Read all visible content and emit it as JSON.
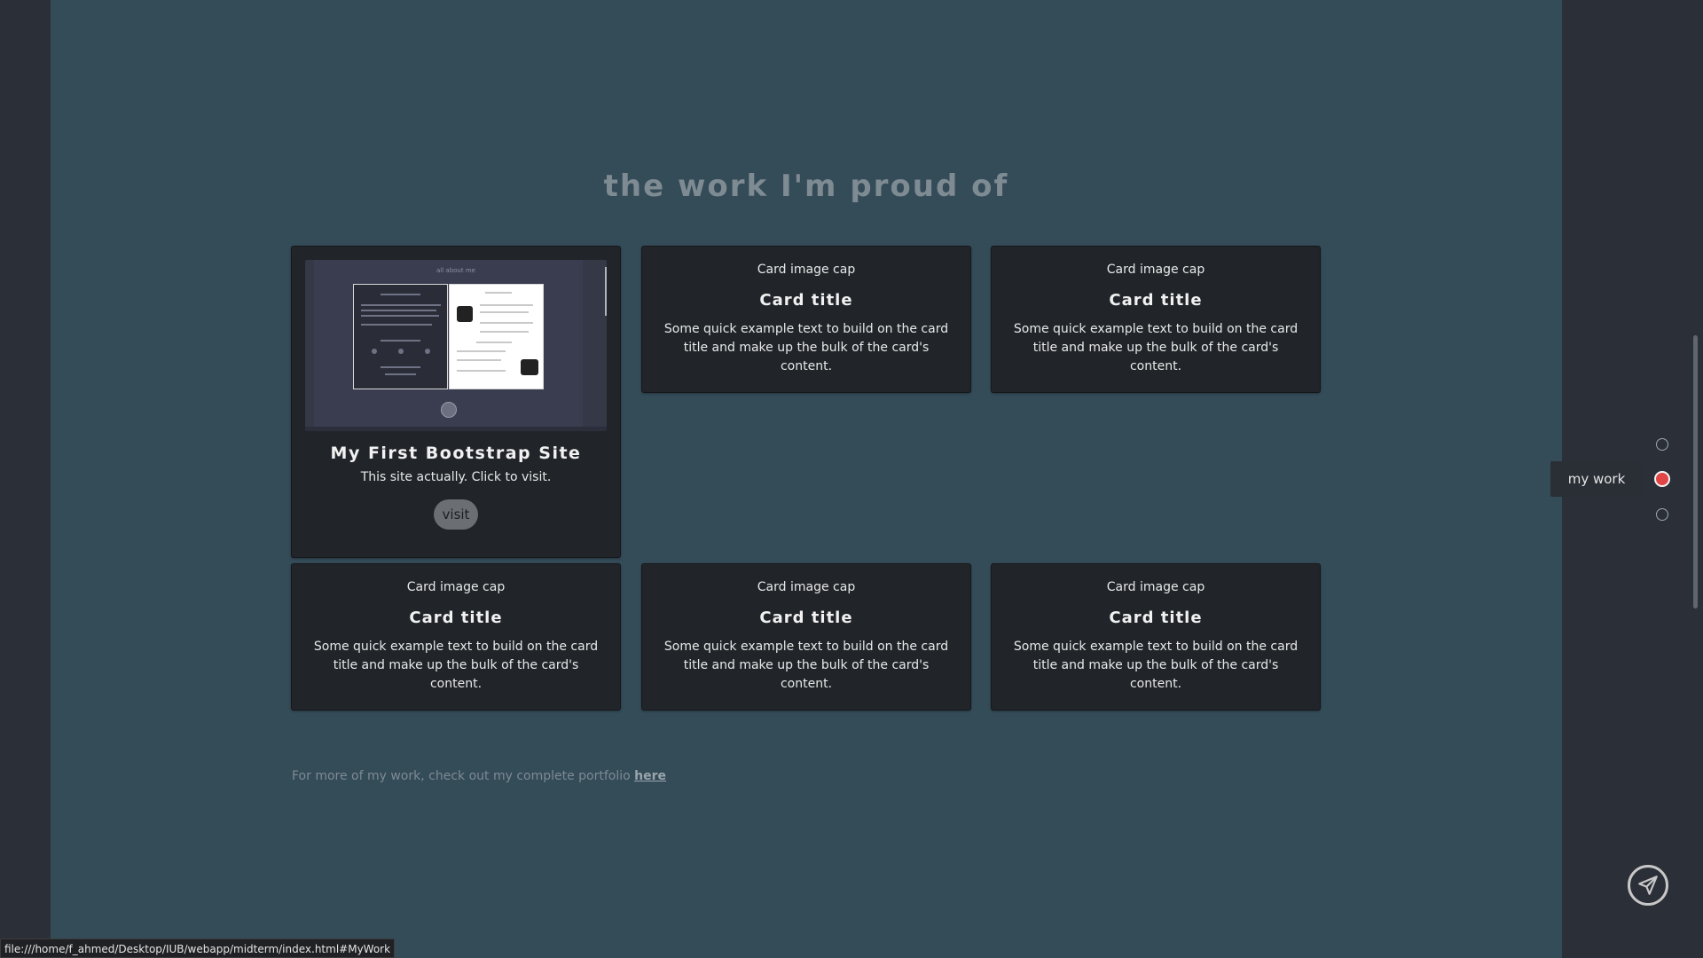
{
  "section": {
    "title": "the work I'm proud of"
  },
  "featured": {
    "title": "My First Bootstrap Site",
    "text": "This site actually. Click to visit.",
    "button": "visit",
    "screenshot_heading": "all about me"
  },
  "cards": [
    {
      "cap": "Card image cap",
      "title": "Card title",
      "text": "Some quick example text to build on the card title and make up the bulk of the card's content."
    },
    {
      "cap": "Card image cap",
      "title": "Card title",
      "text": "Some quick example text to build on the card title and make up the bulk of the card's content."
    },
    {
      "cap": "Card image cap",
      "title": "Card title",
      "text": "Some quick example text to build on the card title and make up the bulk of the card's content."
    },
    {
      "cap": "Card image cap",
      "title": "Card title",
      "text": "Some quick example text to build on the card title and make up the bulk of the card's content."
    },
    {
      "cap": "Card image cap",
      "title": "Card title",
      "text": "Some quick example text to build on the card title and make up the bulk of the card's content."
    }
  ],
  "footer": {
    "text": "For more of my work, check out my complete portfolio ",
    "link": "here"
  },
  "side_nav": {
    "active_label": "my work"
  },
  "status_url": "file:///home/f_ahmed/Desktop/IUB/webapp/midterm/index.html#MyWork",
  "colors": {
    "accent_dot": "#e14545",
    "main_bg": "#344b58",
    "card_bg": "#212529"
  },
  "icons": {
    "send": "paper-plane-icon"
  }
}
